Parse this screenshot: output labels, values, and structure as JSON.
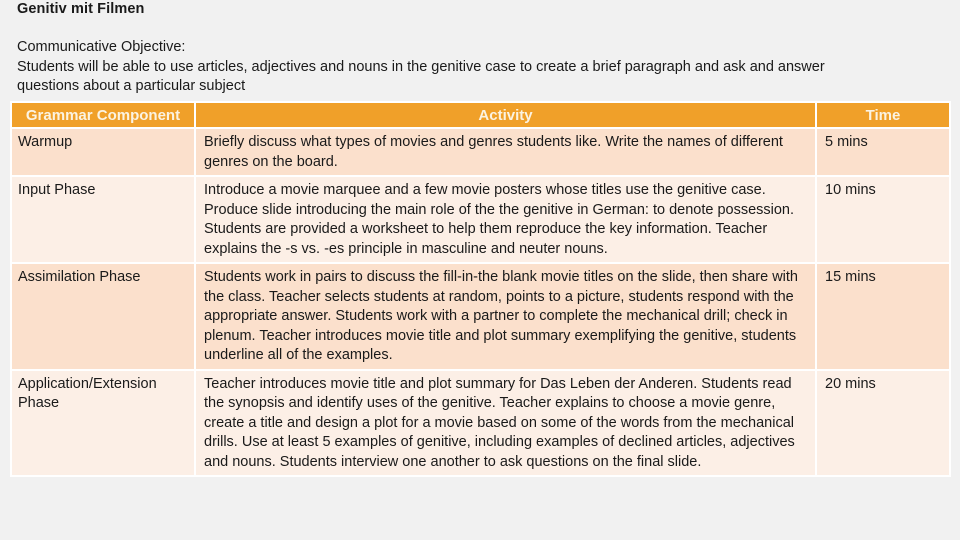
{
  "title": "Genitiv mit Filmen",
  "objective": {
    "label": "Communicative Objective:",
    "lines": [
      "Students will be able to use articles, adjectives and nouns in the genitive case to create a brief paragraph and ask and answer",
      "questions about a particular subject"
    ]
  },
  "table": {
    "headers": {
      "component": "Grammar Component",
      "activity": "Activity",
      "time": "Time"
    },
    "header_color": "#f0a029",
    "row_colors": [
      "#fbe0cc",
      "#fcefe6"
    ],
    "rows": [
      {
        "component": "Warmup",
        "activity": "Briefly discuss what types of movies and genres students like.  Write the names of different genres on the board.",
        "time": "5 mins"
      },
      {
        "component": "Input Phase",
        "activity": "Introduce a movie marquee and a few movie posters whose titles use the genitive case. Produce slide introducing the main role of the the genitive in German: to denote possession. Students are provided a worksheet to help them reproduce the key information. Teacher explains the -s vs. -es principle in masculine and neuter nouns.",
        "time": "10 mins"
      },
      {
        "component": "Assimilation Phase",
        "activity": "Students work in pairs to discuss the fill-in-the blank movie titles on the slide, then share with the class. Teacher selects students at random, points to a picture, students respond with the appropriate answer. Students work with a partner to complete the mechanical drill; check in plenum. Teacher introduces movie title and plot summary exemplifying the genitive, students underline all of the examples.",
        "time": "15 mins"
      },
      {
        "component": "Application/Extension Phase",
        "activity": "Teacher introduces movie title and plot summary for Das Leben der Anderen. Students read the synopsis and identify uses of the genitive. Teacher explains to choose a movie genre, create a title and design a plot for a movie based on some of the words from the mechanical drills. Use at least 5 examples of genitive, including examples of declined articles, adjectives and nouns. Students interview one another to ask questions on the final slide.",
        "time": "20 mins"
      }
    ]
  }
}
